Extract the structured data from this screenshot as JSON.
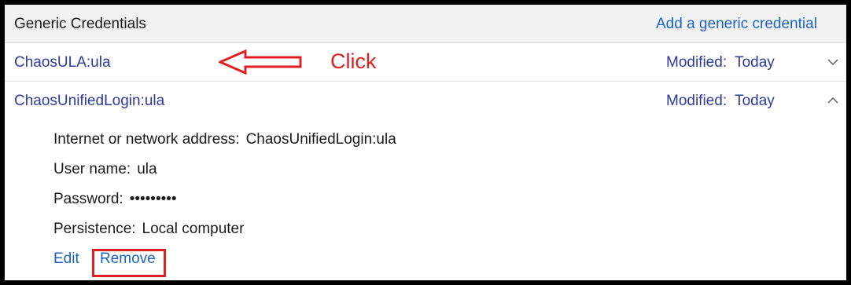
{
  "header": {
    "title": "Generic Credentials",
    "add_link": "Add a generic credential"
  },
  "credentials": [
    {
      "name": "ChaosULA:ula",
      "modified_label": "Modified:",
      "modified_value": "Today",
      "expanded": false
    },
    {
      "name": "ChaosUnifiedLogin:ula",
      "modified_label": "Modified:",
      "modified_value": "Today",
      "expanded": true,
      "details": {
        "address_label": "Internet or network address:",
        "address_value": "ChaosUnifiedLogin:ula",
        "username_label": "User name:",
        "username_value": "ula",
        "password_label": "Password:",
        "password_value": "•••••••••",
        "persistence_label": "Persistence:",
        "persistence_value": "Local computer"
      },
      "actions": {
        "edit": "Edit",
        "remove": "Remove"
      }
    }
  ],
  "annotation": {
    "text": "Click",
    "color": "#e02020"
  },
  "colors": {
    "link": "#1b64c6",
    "name": "#2e3a9c",
    "annotation": "#e02020"
  },
  "icons": {
    "collapsed": "chevron-down-icon",
    "expanded": "chevron-up-icon",
    "annotation_arrow": "arrow-left-icon"
  }
}
